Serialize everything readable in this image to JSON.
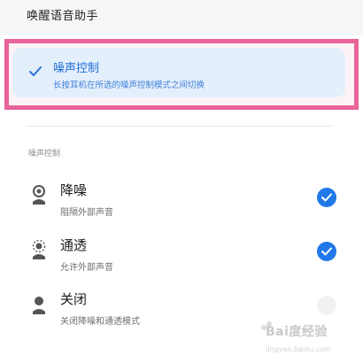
{
  "header": {
    "wake_assistant_label": "唤醒语音助手"
  },
  "selected_option": {
    "title": "噪声控制",
    "subtitle": "长按耳机在所选的噪声控制模式之间切换"
  },
  "noise_section": {
    "label": "噪声控制",
    "options": [
      {
        "title": "降噪",
        "subtitle": "阻隔外部声音",
        "checked": true
      },
      {
        "title": "通透",
        "subtitle": "允许外部声音",
        "checked": true
      },
      {
        "title": "关闭",
        "subtitle": "关闭降噪和通透模式",
        "checked": false
      }
    ]
  },
  "watermark": {
    "text": "Bai度经验",
    "url": "jingyan.baidu.com"
  },
  "colors": {
    "accent": "#2178e8",
    "highlight_border": "#e8639a",
    "selected_bg": "#e4effc"
  },
  "icons": [
    "check-icon",
    "noise-cancel-icon",
    "transparency-icon",
    "off-mode-icon",
    "radio-checked-icon"
  ]
}
